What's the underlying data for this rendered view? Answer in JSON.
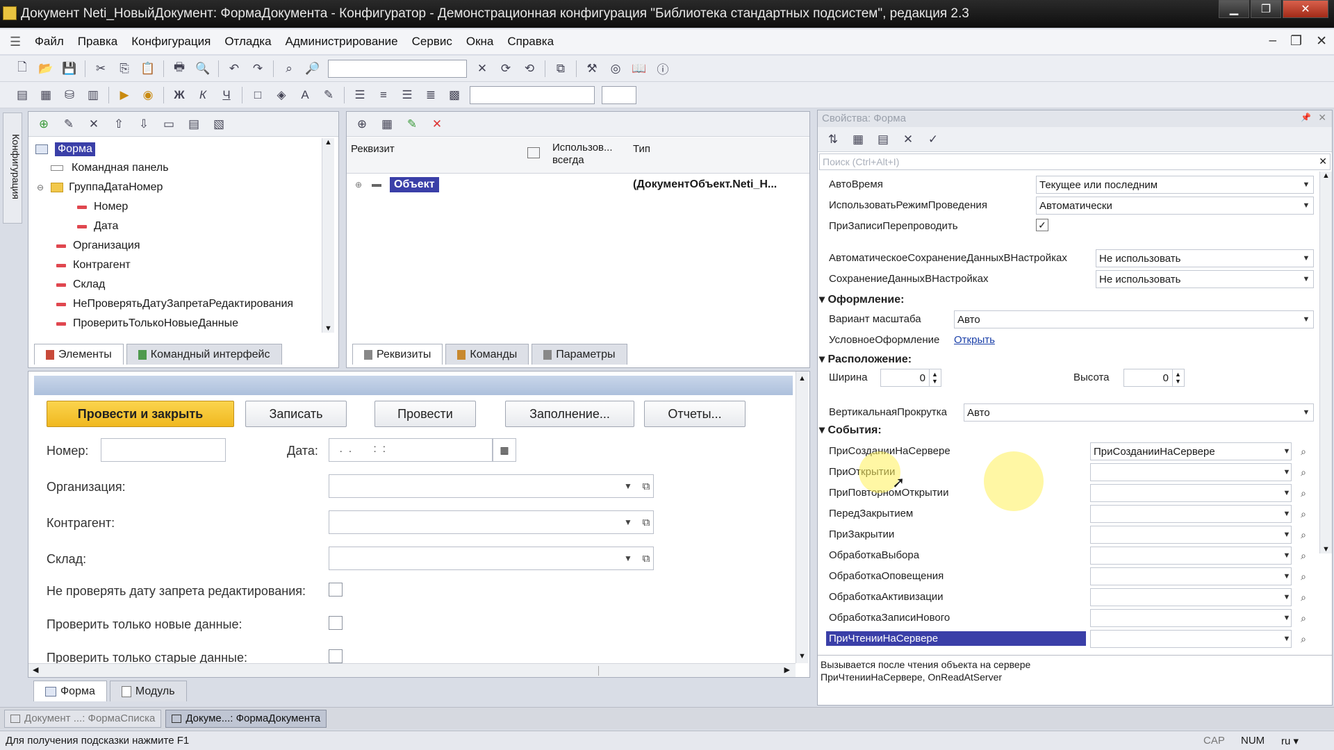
{
  "window": {
    "title": "Документ Neti_НовыйДокумент: ФормаДокумента - Конфигуратор - Демонстрационная конфигурация \"Библиотека стандартных подсистем\", редакция 2.3"
  },
  "menu": {
    "items": [
      "Файл",
      "Правка",
      "Конфигурация",
      "Отладка",
      "Администрирование",
      "Сервис",
      "Окна",
      "Справка"
    ]
  },
  "sidebar": {
    "vertical_tab": "Конфигурация"
  },
  "elements_tree": {
    "items": [
      {
        "label": "Форма",
        "selected": true
      },
      {
        "label": "Командная панель"
      },
      {
        "label": "ГруппаДатаНомер"
      },
      {
        "label": "Номер"
      },
      {
        "label": "Дата"
      },
      {
        "label": "Организация"
      },
      {
        "label": "Контрагент"
      },
      {
        "label": "Склад"
      },
      {
        "label": "НеПроверятьДатуЗапретаРедактирования"
      },
      {
        "label": "ПроверитьТолькоНовыеДанные"
      }
    ],
    "tabs": [
      "Элементы",
      "Командный интерфейс"
    ]
  },
  "attributes": {
    "columns": [
      "Реквизит",
      "Использов... всегда",
      "Тип"
    ],
    "rows": [
      {
        "name": "Объект",
        "type": "(ДокументОбъект.Neti_Н..."
      }
    ],
    "tabs": [
      "Реквизиты",
      "Команды",
      "Параметры"
    ]
  },
  "form_preview": {
    "buttons": [
      "Провести и закрыть",
      "Записать",
      "Провести",
      "Заполнение...",
      "Отчеты..."
    ],
    "number_label": "Номер:",
    "date_label": "Дата:",
    "date_mask": " .  .       :  :",
    "fields": [
      "Организация:",
      "Контрагент:",
      "Склад:"
    ],
    "checkboxes": [
      "Не проверять дату запрета редактирования:",
      "Проверить только новые данные:",
      "Проверить только старые данные:"
    ],
    "bottom_tabs": [
      "Форма",
      "Модуль"
    ]
  },
  "properties": {
    "title": "Свойства: Форма",
    "search_placeholder": "Поиск (Ctrl+Alt+I)",
    "rows": [
      {
        "label": "АвтоВремя",
        "value": "Текущее или последним"
      },
      {
        "label": "ИспользоватьРежимПроведения",
        "value": "Автоматически"
      },
      {
        "label": "ПриЗаписиПерепроводить",
        "value": "✓"
      },
      {
        "label": "АвтоматическоеСохранениеДанныхВНастройках",
        "value": "Не использовать"
      },
      {
        "label": "СохранениеДанныхВНастройках",
        "value": "Не использовать"
      }
    ],
    "section_design": "Оформление:",
    "scale_label": "Вариант масштаба",
    "scale_value": "Авто",
    "cond_label": "УсловноеОформление",
    "cond_link": "Открыть",
    "section_layout": "Расположение:",
    "width_label": "Ширина",
    "width_value": "0",
    "height_label": "Высота",
    "height_value": "0",
    "vscroll_label": "ВертикальнаяПрокрутка",
    "vscroll_value": "Авто",
    "section_events": "События:",
    "events": [
      {
        "label": "ПриСозданииНаСервере",
        "value": "ПриСозданииНаСервере"
      },
      {
        "label": "ПриОткрытии",
        "value": ""
      },
      {
        "label": "ПриПовторномОткрытии",
        "value": ""
      },
      {
        "label": "ПередЗакрытием",
        "value": ""
      },
      {
        "label": "ПриЗакрытии",
        "value": ""
      },
      {
        "label": "ОбработкаВыбора",
        "value": ""
      },
      {
        "label": "ОбработкаОповещения",
        "value": ""
      },
      {
        "label": "ОбработкаАктивизации",
        "value": ""
      },
      {
        "label": "ОбработкаЗаписиНового",
        "value": ""
      },
      {
        "label": "ПриЧтенииНаСервере",
        "value": ""
      }
    ],
    "description_line1": "Вызывается после чтения объекта на сервере",
    "description_line2": "ПриЧтенииНаСервере, OnReadAtServer"
  },
  "taskbar": {
    "items": [
      "Документ ...: ФормаСписка",
      "Докуме...: ФормаДокумента"
    ]
  },
  "status": {
    "hint": "Для получения подсказки нажмите F1",
    "caps": "CAP",
    "num": "NUM",
    "lang": "ru"
  },
  "colors": {
    "primary_button": "#f0b820",
    "selection": "#3a3fa8",
    "event_handler_link": "#1a3fa8"
  }
}
